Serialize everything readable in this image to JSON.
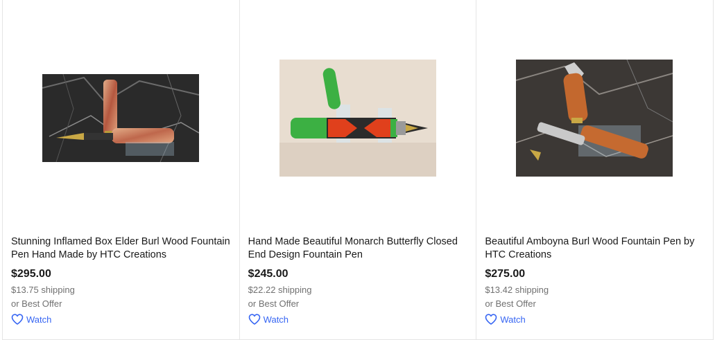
{
  "listings": [
    {
      "title": "Stunning Inflamed Box Elder Burl Wood Fountain Pen Hand Made by HTC Creations",
      "price": "$295.00",
      "shipping": "$13.75 shipping",
      "offer": "or Best Offer",
      "watch_label": "Watch",
      "image_icon": "box-elder-burl-pen-photo"
    },
    {
      "title": "Hand Made Beautiful Monarch Butterfly Closed End Design Fountain Pen",
      "price": "$245.00",
      "shipping": "$22.22 shipping",
      "offer": "or Best Offer",
      "watch_label": "Watch",
      "image_icon": "monarch-butterfly-pen-photo"
    },
    {
      "title": "Beautiful Amboyna Burl Wood Fountain Pen by HTC Creations",
      "price": "$275.00",
      "shipping": "$13.42 shipping",
      "offer": "or Best Offer",
      "watch_label": "Watch",
      "image_icon": "amboyna-burl-pen-photo"
    }
  ],
  "colors": {
    "link_blue": "#3665f3",
    "text": "#191919",
    "muted": "#707070"
  }
}
